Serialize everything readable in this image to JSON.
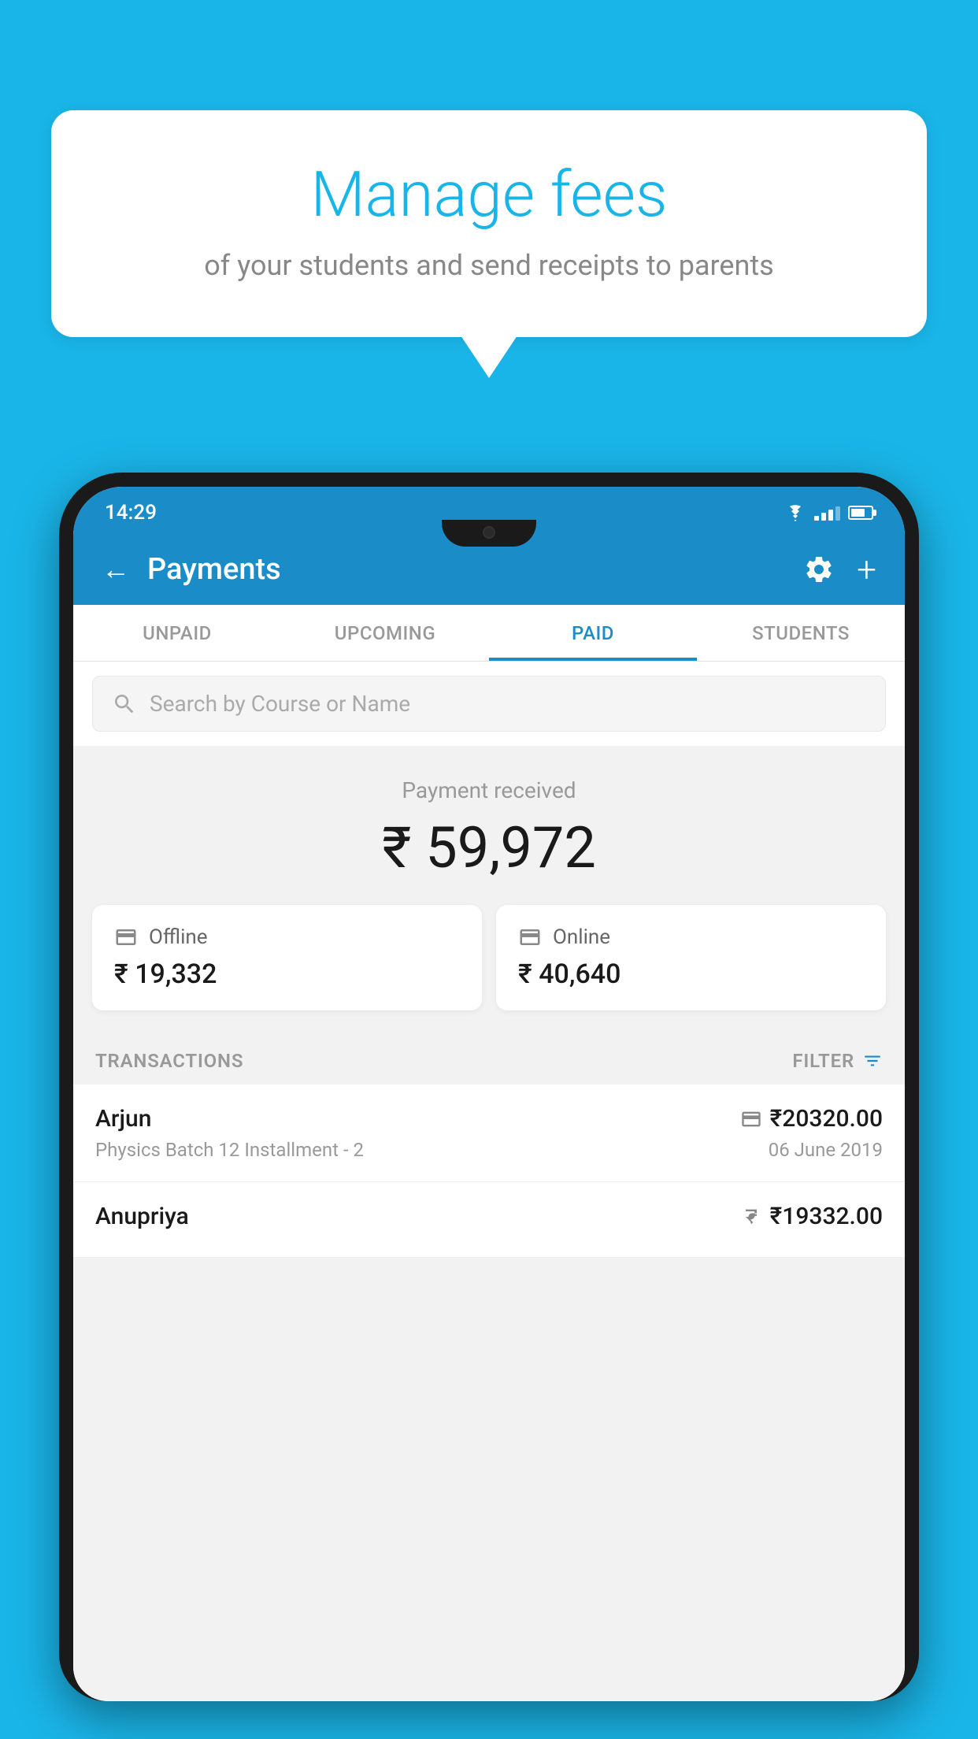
{
  "background_color": "#1ab5e8",
  "speech_bubble": {
    "title": "Manage fees",
    "subtitle": "of your students and send receipts to parents"
  },
  "status_bar": {
    "time": "14:29"
  },
  "header": {
    "title": "Payments",
    "back_label": "←",
    "settings_icon": "gear",
    "add_icon": "+"
  },
  "tabs": [
    {
      "label": "UNPAID",
      "active": false
    },
    {
      "label": "UPCOMING",
      "active": false
    },
    {
      "label": "PAID",
      "active": true
    },
    {
      "label": "STUDENTS",
      "active": false
    }
  ],
  "search": {
    "placeholder": "Search by Course or Name"
  },
  "payment_received": {
    "label": "Payment received",
    "amount": "₹ 59,972"
  },
  "payment_cards": [
    {
      "type": "Offline",
      "amount": "₹ 19,332",
      "icon": "offline"
    },
    {
      "type": "Online",
      "amount": "₹ 40,640",
      "icon": "online"
    }
  ],
  "transactions_header": {
    "label": "TRANSACTIONS",
    "filter_label": "FILTER"
  },
  "transactions": [
    {
      "name": "Arjun",
      "amount": "₹20320.00",
      "course": "Physics Batch 12 Installment - 2",
      "date": "06 June 2019",
      "payment_type": "online"
    },
    {
      "name": "Anupriya",
      "amount": "₹19332.00",
      "course": "",
      "date": "",
      "payment_type": "offline"
    }
  ]
}
